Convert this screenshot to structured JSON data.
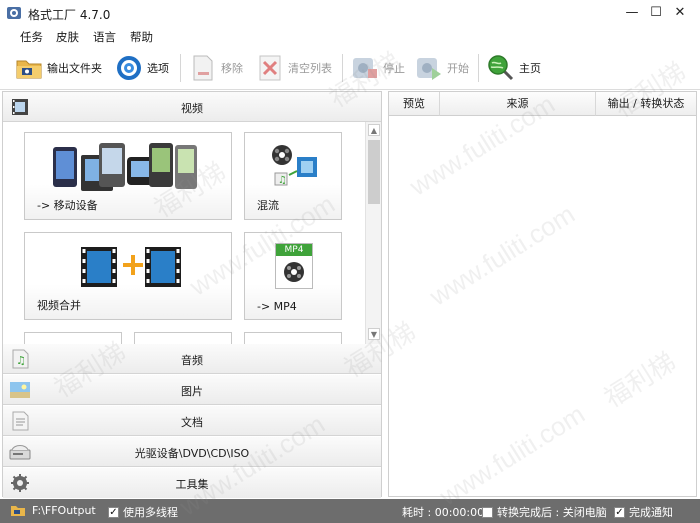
{
  "window": {
    "title": "格式工厂 4.7.0",
    "controls": {
      "minimize": "—",
      "maximize": "☐",
      "close": "✕"
    }
  },
  "menu": [
    "任务",
    "皮肤",
    "语言",
    "帮助"
  ],
  "toolbar": {
    "output_folder": "输出文件夹",
    "options": "选项",
    "remove": "移除",
    "clear_list": "清空列表",
    "stop": "停止",
    "start": "开始",
    "home": "主页"
  },
  "categories": {
    "video": "视频",
    "audio": "音频",
    "image": "图片",
    "document": "文档",
    "optical": "光驱设备\\DVD\\CD\\ISO",
    "tools": "工具集"
  },
  "video_tiles": {
    "mobile": "-> 移动设备",
    "mix": "混流",
    "join": "视频合并",
    "mp4": "-> MP4",
    "mp4_badge": "MP4"
  },
  "task_columns": [
    "预览",
    "来源",
    "输出 / 转换状态"
  ],
  "status": {
    "output_path": "F:\\FFOutput",
    "multithread": "使用多线程",
    "elapsed_label": "耗时 : 00:00:00",
    "after_convert": "转换完成后 : 关闭电脑",
    "notify": "完成通知"
  },
  "watermark": {
    "cn": "福利梯",
    "en": "www.fuliti.com"
  },
  "colors": {
    "statusbar": "#6d6d6d",
    "accent_green": "#3fa33a",
    "film_blue": "#2a7fc8",
    "orange_plus": "#f2a21b"
  }
}
